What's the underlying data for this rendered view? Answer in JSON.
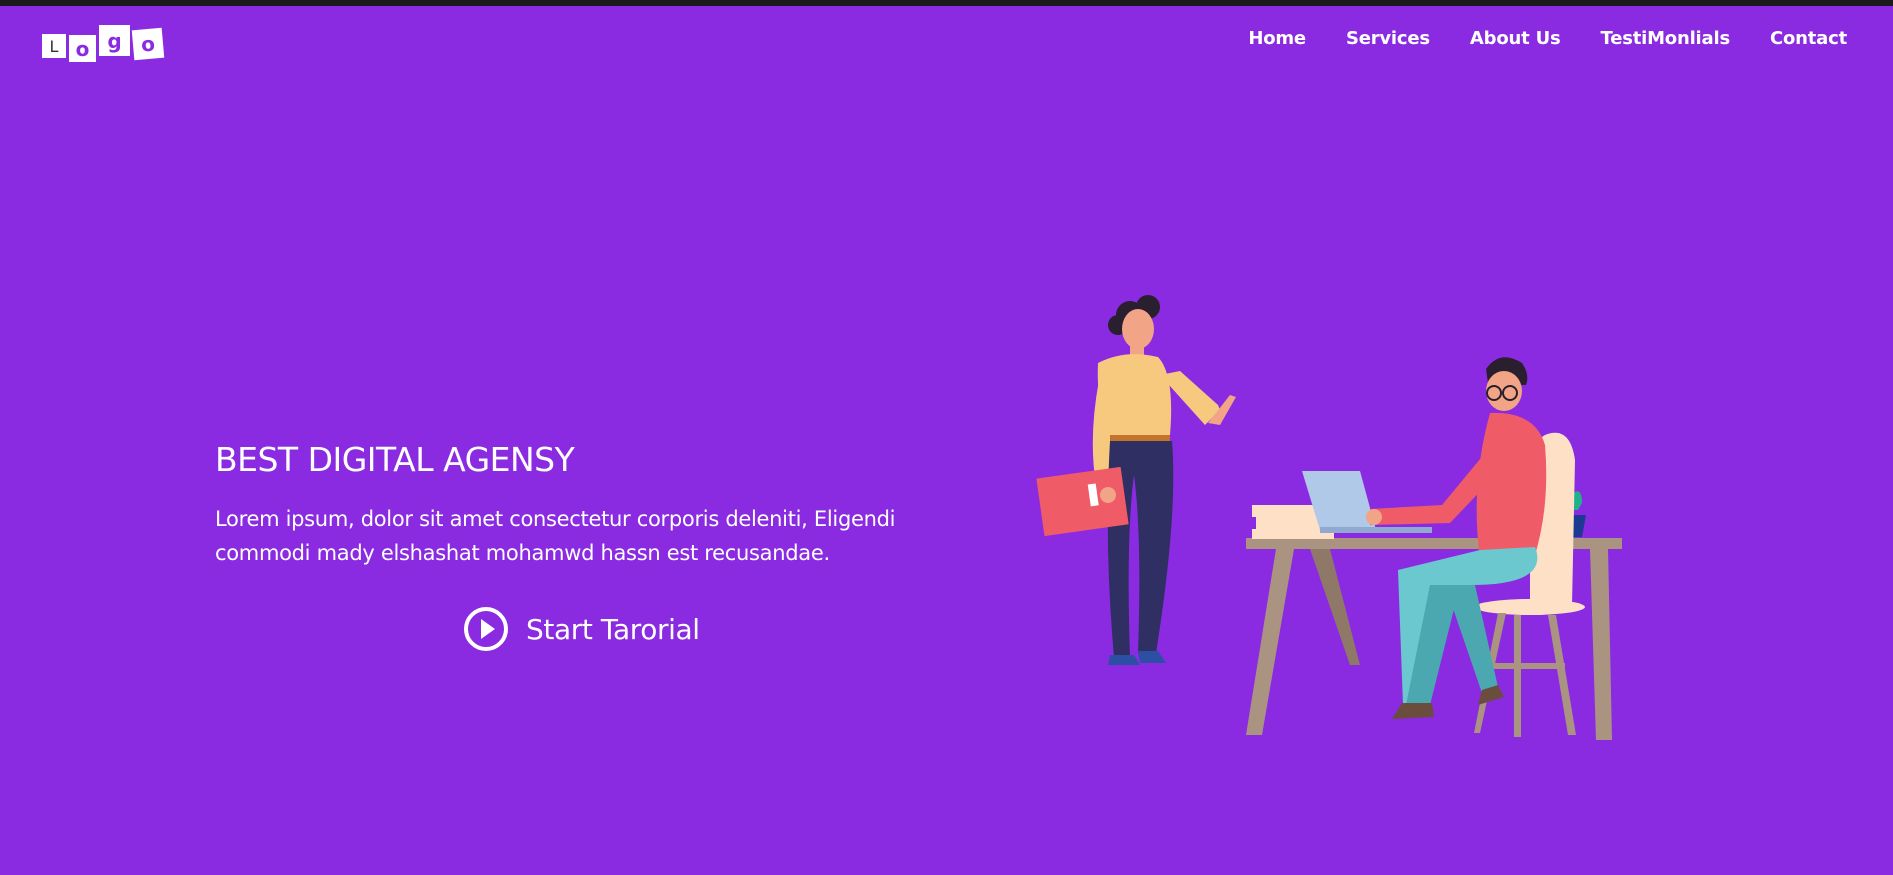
{
  "header": {
    "logo_letters": [
      "L",
      "o",
      "g",
      "o"
    ],
    "nav": [
      {
        "label": "Home"
      },
      {
        "label": "Services"
      },
      {
        "label": "About Us"
      },
      {
        "label": "TestiMonlials"
      },
      {
        "label": "Contact"
      }
    ]
  },
  "hero": {
    "title": "BEST DIGITAL AGENSY",
    "description": "Lorem ipsum, dolor sit amet consectetur corporis deleniti, Eligendi commodi mady elshashat mohamwd hassn est recusandae.",
    "cta_label": "Start Tarorial",
    "cta_icon": "play-circle-icon"
  },
  "colors": {
    "background": "#8a2be2",
    "text": "#ffffff"
  }
}
